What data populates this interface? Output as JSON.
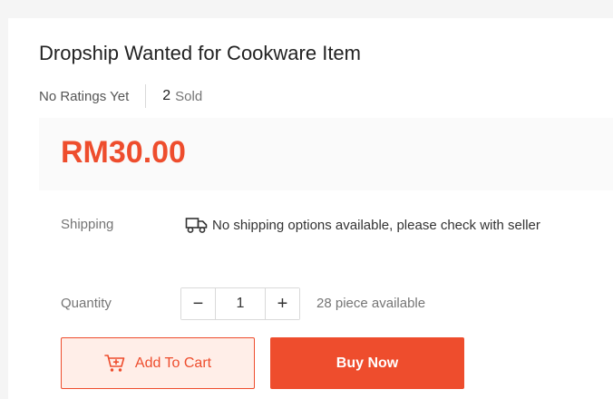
{
  "product": {
    "title": "Dropship Wanted for Cookware Item",
    "ratings_text": "No Ratings Yet",
    "sold_count": "2",
    "sold_label": "Sold",
    "price": "RM30.00"
  },
  "shipping": {
    "label": "Shipping",
    "icon": "truck-icon",
    "text": "No shipping options available, please check with seller"
  },
  "quantity": {
    "label": "Quantity",
    "decrement": "−",
    "value": "1",
    "increment": "+",
    "available_text": "28 piece available"
  },
  "actions": {
    "add_to_cart_icon": "cart-plus-icon",
    "add_to_cart": "Add To Cart",
    "buy_now": "Buy Now"
  },
  "colors": {
    "accent": "#ee4d2d",
    "accent_light": "#ffeee8",
    "price_bg": "#fafafa",
    "page_bg": "#f5f5f5"
  }
}
